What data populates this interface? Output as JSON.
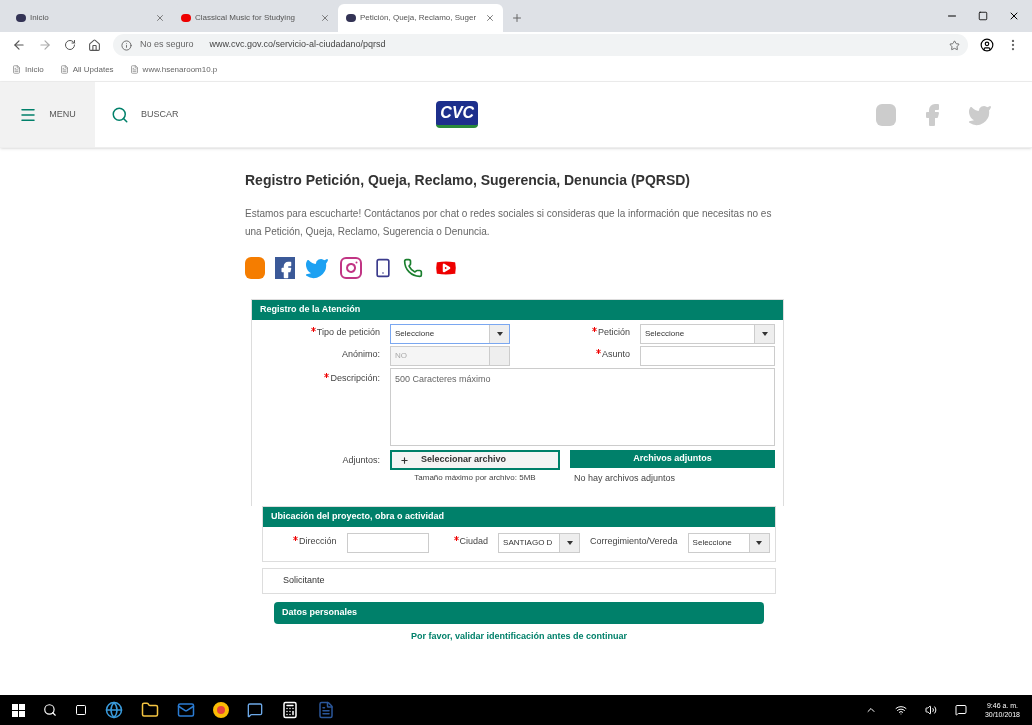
{
  "browser": {
    "tabs": [
      {
        "title": "Inicio",
        "selected": false
      },
      {
        "title": "Classical Music for Studying",
        "selected": false
      },
      {
        "title": "Petición, Queja, Reclamo, Suger",
        "selected": true
      }
    ],
    "security": "No es seguro",
    "url": "www.cvc.gov.co/servicio-al-ciudadano/pqrsd",
    "bookmarks": [
      "Inicio",
      "All Updates",
      "www.hsenaroom10.p"
    ]
  },
  "header": {
    "menu": "MENU",
    "search": "BUSCAR",
    "logo": "CVC"
  },
  "page": {
    "title": "Registro Petición, Queja, Reclamo, Sugerencia, Denuncia (PQRSD)",
    "intro": "Estamos para escucharte! Contáctanos por chat o redes sociales si consideras que la información que necesitas no es una Petición, Queja, Reclamo, Sugerencia o Denuncia."
  },
  "registro": {
    "title": "Registro de la Atención",
    "fields": [
      {
        "label": "Tipo de petición",
        "required": true,
        "kind": "select",
        "value": "Seleccione",
        "disabled": false,
        "focused": true
      },
      {
        "label": "Petición",
        "required": true,
        "kind": "select",
        "value": "Seleccione",
        "disabled": false,
        "focused": false
      },
      {
        "label": "Anónimo:",
        "required": false,
        "kind": "select",
        "value": "NO",
        "disabled": true,
        "focused": false
      },
      {
        "label": "Asunto",
        "required": true,
        "kind": "input"
      }
    ],
    "description": {
      "label": "Descripción:",
      "required": true,
      "placeholder": "500 Caracteres máximo"
    },
    "attachments": {
      "label": "Adjuntos:",
      "button": "Seleccionar archivo",
      "note": "Tamaño máximo por archivo: 5MB",
      "table_title": "Archivos adjuntos",
      "empty": "No hay archivos adjuntos"
    }
  },
  "ubicacion": {
    "title": "Ubicación del proyecto, obra o actividad",
    "fields": [
      {
        "label": "Dirección",
        "required": true,
        "kind": "input"
      },
      {
        "label": "Ciudad",
        "required": true,
        "kind": "select",
        "value": "SANTIAGO D"
      },
      {
        "label": "Corregimiento/Vereda",
        "required": false,
        "kind": "select",
        "value": "Seleccione"
      }
    ]
  },
  "solicitante": {
    "title": "Solicitante"
  },
  "datos": {
    "title": "Datos personales",
    "message": "Por favor, validar identificación antes de continuar"
  },
  "taskbar": {
    "time": "9:46 a. m.",
    "date": "30/10/2018"
  }
}
